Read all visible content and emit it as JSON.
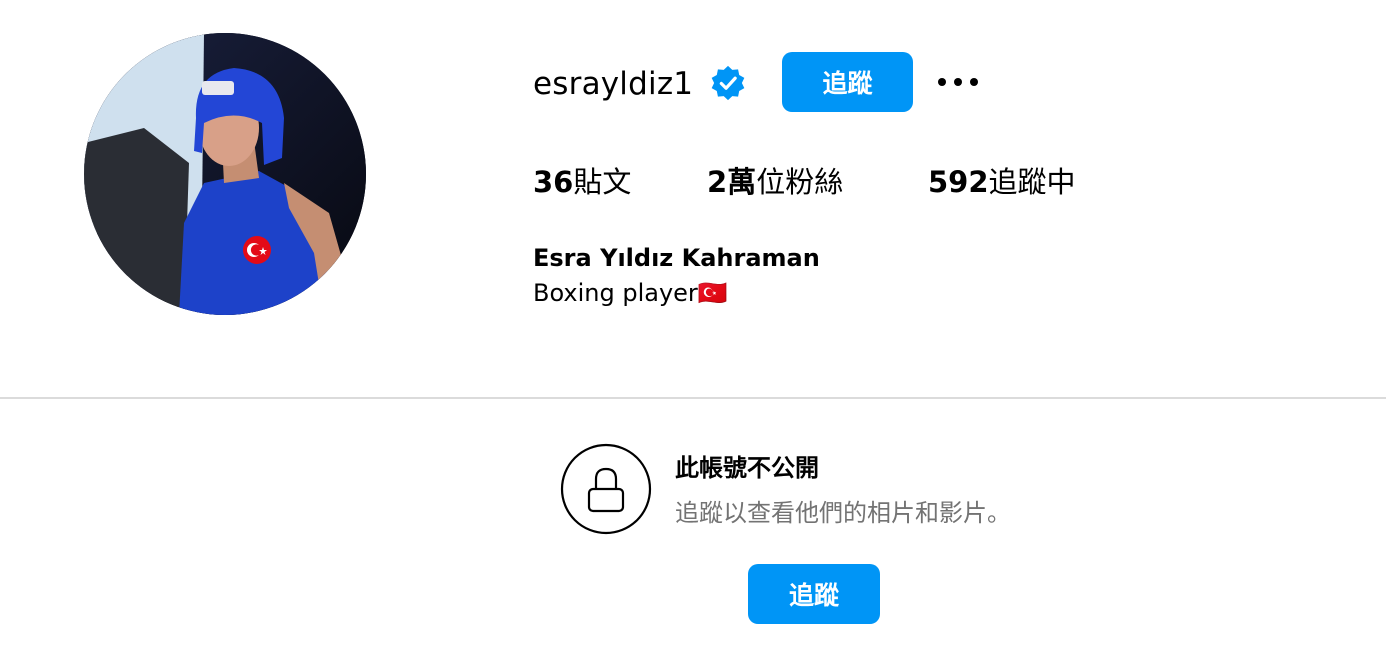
{
  "colors": {
    "accent": "#0095f6",
    "divider": "#dbdbdb",
    "secondary_text": "#737373",
    "text": "#000000",
    "background": "#ffffff"
  },
  "profile": {
    "username": "esrayldiz1",
    "verified_icon": "verified-badge-icon",
    "follow_label": "追蹤",
    "more_icon": "more-options-icon",
    "avatar_icon": "profile-photo"
  },
  "stats": {
    "posts_count": "36",
    "posts_label": "貼文",
    "followers_count": "2萬",
    "followers_label": "位粉絲",
    "following_count": "592",
    "following_label": "追蹤中"
  },
  "bio": {
    "full_name": "Esra Yıldız Kahraman",
    "description": "Boxing player🇹🇷"
  },
  "private_notice": {
    "lock_icon": "lock-icon",
    "title": "此帳號不公開",
    "subtitle": "追蹤以查看他們的相片和影片。",
    "follow_label": "追蹤"
  }
}
